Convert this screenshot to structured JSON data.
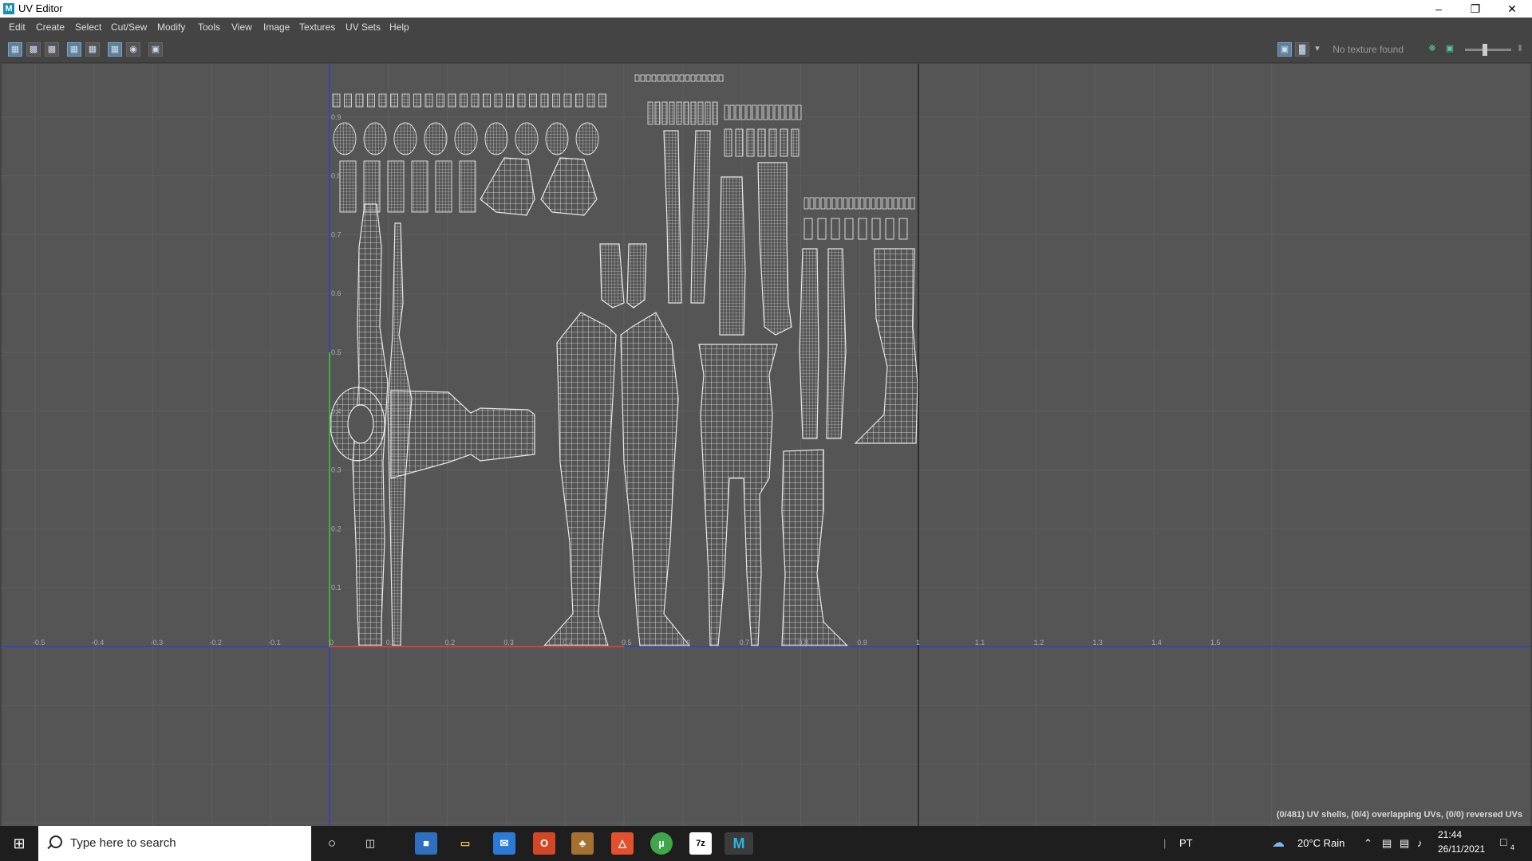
{
  "window": {
    "title": "UV Editor",
    "app_icon": "maya-icon",
    "controls": [
      "minimize-icon",
      "restore-icon",
      "close-icon"
    ]
  },
  "menu": [
    "Edit",
    "Create",
    "Select",
    "Cut/Sew",
    "Modify",
    "Tools",
    "View",
    "Image",
    "Textures",
    "UV Sets",
    "Help"
  ],
  "toolbar": {
    "texture_status": "No texture found"
  },
  "grid": {
    "u_labels": [
      "-0.5",
      "-0.4",
      "-0.3",
      "-0.2",
      "-0.1",
      "0",
      "0.1",
      "0.2",
      "0.3",
      "0.4",
      "0.5",
      "0.6",
      "0.7",
      "0.8",
      "0.9",
      "1",
      "1.1",
      "1.2",
      "1.3",
      "1.4",
      "1.5"
    ],
    "v_labels": [
      "0.1",
      "0.2",
      "0.3",
      "0.4",
      "0.5",
      "0.6",
      "0.7",
      "0.8",
      "0.9",
      "1"
    ],
    "colors": {
      "u_axis": "#d04040",
      "v_axis": "#40b040",
      "frame": "#3040d0",
      "background": "#555555",
      "grid": "#5f5f5f",
      "uv": "#e8e8e8"
    }
  },
  "status": {
    "text": "(0/481) UV shells, (0/4) overlapping UVs, (0/0) reversed UVs"
  },
  "taskbar": {
    "search_placeholder": "Type here to search",
    "language": "PT",
    "weather": "20°C  Rain",
    "time": "21:44",
    "date": "26/11/2021",
    "notifications": "4"
  }
}
